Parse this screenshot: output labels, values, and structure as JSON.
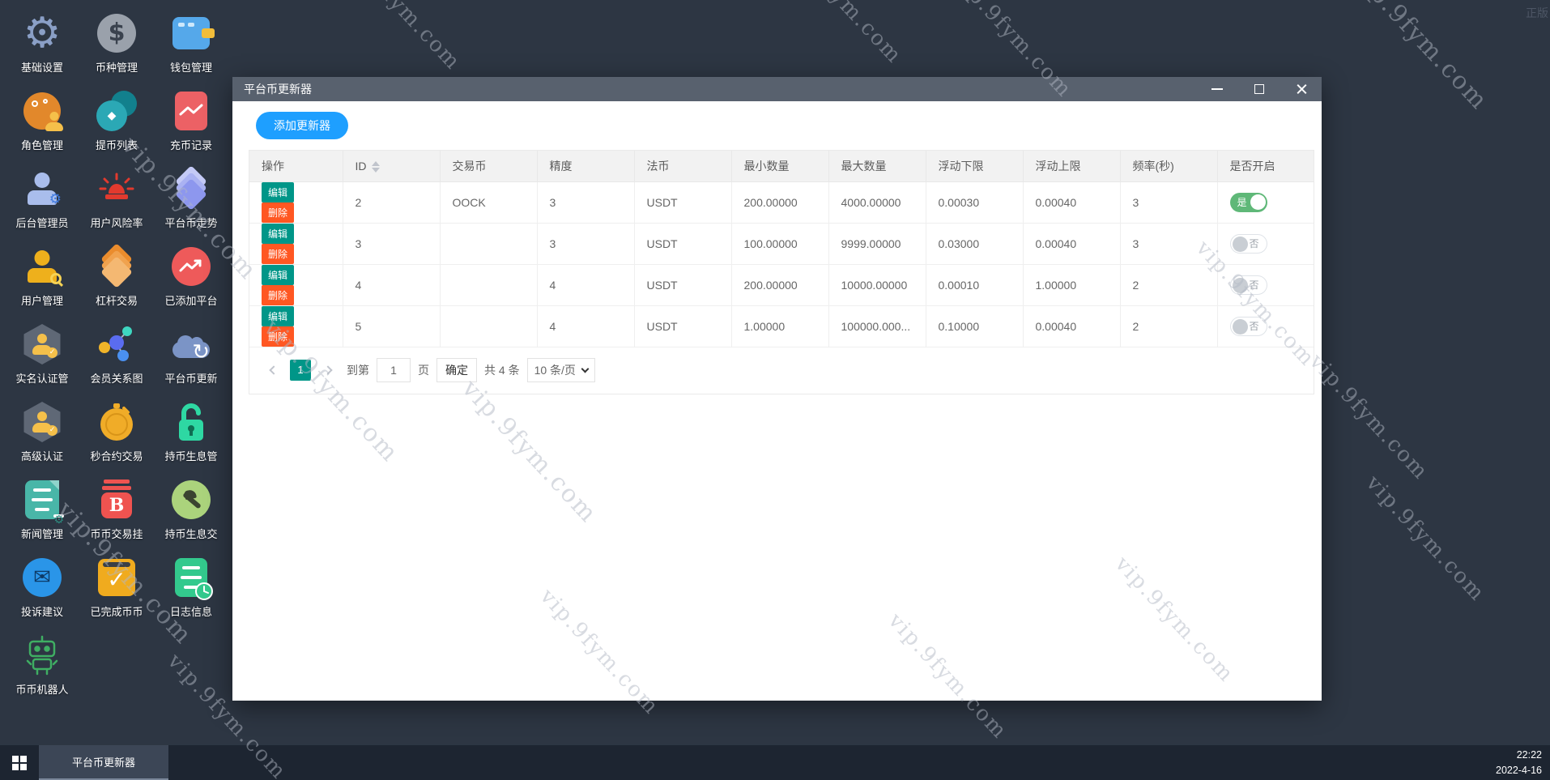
{
  "watermark": {
    "text": "vip.9fym.com"
  },
  "corner_badge": "正版",
  "colors": {
    "accent_blue": "#1E9FFF",
    "teal": "#009688",
    "orange_red": "#FF5722",
    "toggle_green": "#5FB878",
    "titlebar": "#58616e",
    "desktop_bg": "#2d3643",
    "taskbar_bg": "#1d2531"
  },
  "desktop": {
    "icons": [
      {
        "label": "基础设置",
        "glyph": "⚙"
      },
      {
        "label": "币种管理",
        "glyph": "$"
      },
      {
        "label": "钱包管理",
        "glyph": ""
      },
      {
        "label": "角色管理",
        "glyph": ""
      },
      {
        "label": "提币列表",
        "glyph": "◆"
      },
      {
        "label": "充币记录",
        "glyph": ""
      },
      {
        "label": "后台管理员",
        "glyph": "⚙"
      },
      {
        "label": "用户风险率",
        "glyph": ""
      },
      {
        "label": "平台币走势",
        "glyph": ""
      },
      {
        "label": "用户管理",
        "glyph": ""
      },
      {
        "label": "杠杆交易",
        "glyph": ""
      },
      {
        "label": "已添加平台",
        "glyph": ""
      },
      {
        "label": "实名认证管",
        "glyph": "✓"
      },
      {
        "label": "会员关系图",
        "glyph": ""
      },
      {
        "label": "平台币更新",
        "glyph": "↻"
      },
      {
        "label": "高级认证",
        "glyph": "✓"
      },
      {
        "label": "秒合约交易",
        "glyph": ""
      },
      {
        "label": "持币生息管",
        "glyph": ""
      },
      {
        "label": "新闻管理",
        "glyph": "⚙"
      },
      {
        "label": "币币交易挂",
        "glyph": "B"
      },
      {
        "label": "持币生息交",
        "glyph": ""
      },
      {
        "label": "投诉建议",
        "glyph": "✉"
      },
      {
        "label": "已完成币币",
        "glyph": "✓"
      },
      {
        "label": "日志信息",
        "glyph": ""
      },
      {
        "label": "币币机器人",
        "glyph": ""
      }
    ]
  },
  "window": {
    "title": "平台币更新器",
    "add_button": "添加更新器",
    "table": {
      "headers": [
        "操作",
        "ID",
        "交易币",
        "精度",
        "法币",
        "最小数量",
        "最大数量",
        "浮动下限",
        "浮动上限",
        "频率(秒)",
        "是否开启"
      ],
      "edit_label": "编辑",
      "delete_label": "删除",
      "rows": [
        {
          "id": "2",
          "coin": "OOCK",
          "precision": "3",
          "fiat": "USDT",
          "min": "200.00000",
          "max": "4000.00000",
          "float_min": "0.00030",
          "float_max": "0.00040",
          "freq": "3",
          "toggle_label": "是"
        },
        {
          "id": "3",
          "coin": "",
          "precision": "3",
          "fiat": "USDT",
          "min": "100.00000",
          "max": "9999.00000",
          "float_min": "0.03000",
          "float_max": "0.00040",
          "freq": "3",
          "toggle_label": "否"
        },
        {
          "id": "4",
          "coin": "",
          "precision": "4",
          "fiat": "USDT",
          "min": "200.00000",
          "max": "10000.00000",
          "float_min": "0.00010",
          "float_max": "1.00000",
          "freq": "2",
          "toggle_label": "否"
        },
        {
          "id": "5",
          "coin": "",
          "precision": "4",
          "fiat": "USDT",
          "min": "1.00000",
          "max": "100000.000...",
          "float_min": "0.10000",
          "float_max": "0.00040",
          "freq": "2",
          "toggle_label": "否"
        }
      ]
    },
    "pagination": {
      "page": "1",
      "goto_prefix": "到第",
      "goto_value": "1",
      "goto_suffix": "页",
      "confirm": "确定",
      "total": "共 4 条",
      "page_size": "10 条/页"
    }
  },
  "taskbar": {
    "task_label": "平台币更新器",
    "clock_time": "22:22",
    "clock_date": "2022-4-16"
  }
}
